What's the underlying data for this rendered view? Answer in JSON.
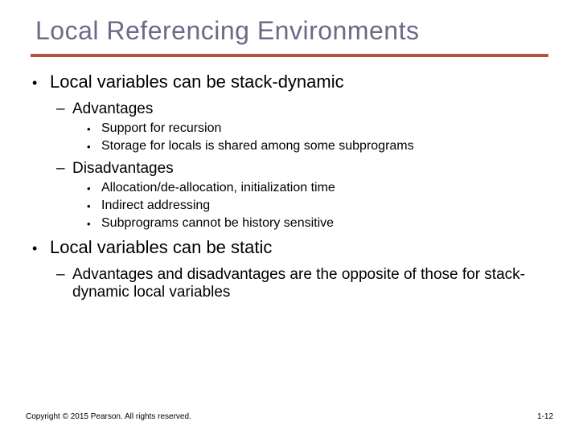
{
  "title": "Local Referencing Environments",
  "points": {
    "p1": "Local variables can be stack-dynamic",
    "p1a": "Advantages",
    "p1a1": "Support for recursion",
    "p1a2": "Storage for locals is shared among some subprograms",
    "p1b": "Disadvantages",
    "p1b1": "Allocation/de-allocation, initialization time",
    "p1b2": "Indirect addressing",
    "p1b3": "Subprograms cannot be history sensitive",
    "p2": "Local variables can be static",
    "p2a": "Advantages and disadvantages are the opposite of those for stack-dynamic local variables"
  },
  "footer": {
    "copyright": "Copyright © 2015 Pearson. All rights reserved.",
    "pagenum": "1-12"
  }
}
